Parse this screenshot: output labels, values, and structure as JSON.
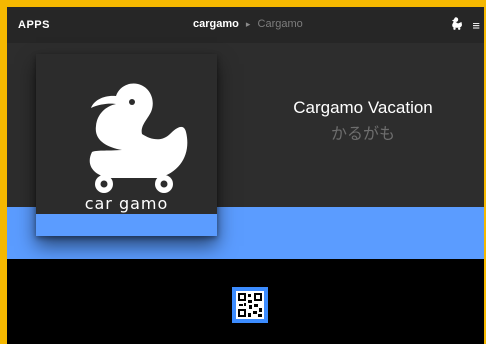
{
  "header": {
    "apps_label": "APPS",
    "app_name": "cargamo",
    "separator": "▸",
    "sub_name": "Cargamo"
  },
  "app": {
    "logo_text": "car gamo",
    "title": "Cargamo Vacation",
    "subtitle": "かるがも"
  },
  "colors": {
    "accent_blue": "#5b9cff",
    "frame_yellow": "#f5b800",
    "dark_bg": "#2b2b2b"
  },
  "icons": {
    "top_right": [
      "duck-icon",
      "menu-icon"
    ],
    "bottom": "qr-code-icon"
  }
}
